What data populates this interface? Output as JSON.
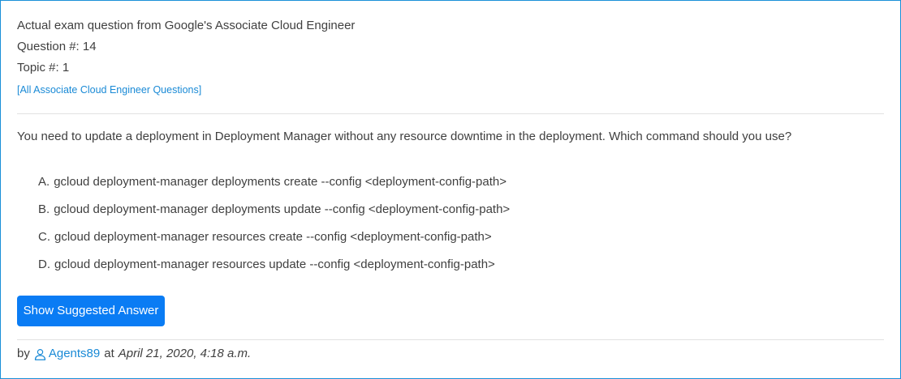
{
  "header": {
    "exam_line": "Actual exam question from Google's Associate Cloud Engineer",
    "question_number": "Question #: 14",
    "topic": "Topic #: 1",
    "all_questions_link": "[All Associate Cloud Engineer Questions]"
  },
  "question": {
    "text": "You need to update a deployment in Deployment Manager without any resource downtime in the deployment. Which command should you use?",
    "choices": [
      {
        "letter": "A.",
        "text": "gcloud deployment-manager deployments create --config <deployment-config-path>"
      },
      {
        "letter": "B.",
        "text": "gcloud deployment-manager deployments update --config <deployment-config-path>"
      },
      {
        "letter": "C.",
        "text": "gcloud deployment-manager resources create --config <deployment-config-path>"
      },
      {
        "letter": "D.",
        "text": "gcloud deployment-manager resources update --config <deployment-config-path>"
      }
    ]
  },
  "actions": {
    "show_answer_label": "Show Suggested Answer"
  },
  "footer": {
    "by_label": "by",
    "author": "Agents89",
    "at_label": "at",
    "date": "April 21, 2020, 4:18 a.m.",
    "user_icon": "user-icon"
  },
  "colors": {
    "accent": "#0a7cf4",
    "link": "#1a8ad6",
    "border": "#1a90d8",
    "text": "#3f3f3f"
  }
}
